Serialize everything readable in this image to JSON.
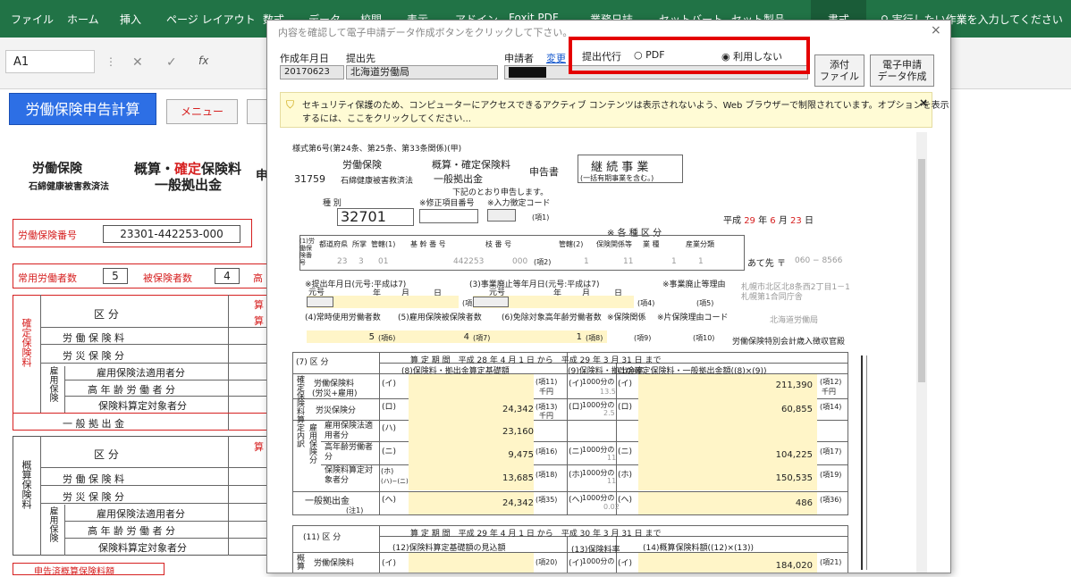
{
  "ribbon": {
    "tabs": [
      "ファイル",
      "ホーム",
      "挿入",
      "ページ レイアウト",
      "数式",
      "データ",
      "校閲",
      "表示",
      "アドイン",
      "Foxit PDF",
      "業務日誌",
      "セットバート",
      "セット製品",
      "書式"
    ],
    "search": "実行したい作業を入力してください"
  },
  "formula_bar": {
    "cell": "A1",
    "fx": "fx"
  },
  "sheet": {
    "title_button": "労働保険申告計算",
    "menu_button": "メニュー",
    "h_ins": "労働保険",
    "h_asb": "石綿健康被害救済法",
    "h_gaisan": "概算・",
    "h_kakutei": "確定",
    "h_hoken": "保険料",
    "h_ippan": "一般拠出金",
    "h_shin": "申",
    "label_no": "労働保険番号",
    "val_no": "23301-442253-000",
    "label_workers": "常用労働者数",
    "val_workers": "5",
    "label_ins": "被保険者数",
    "val_ins": "4",
    "label_ko": "高",
    "kubun": "区 分",
    "kaku_side": "確定保険料",
    "gai_side": "概算保険料",
    "row_rodo": "労 働 保 険 料",
    "row_rosai": "労 災 保 険 分",
    "koyou_side": "雇用保険",
    "row_tekiyo": "雇用保険法適用者分",
    "row_korei": "高 年 齢 労 働 者 分",
    "row_taisho": "保険料算定対象者分",
    "row_ippan": "一 般 拠 出 金",
    "bottom": "申告済概算保険料額",
    "cell_san": "算",
    "cell_ken": "算"
  },
  "dialog": {
    "title": "内容を確認して電子申請データ作成ボタンをクリックして下さい。",
    "close": "×",
    "label_date": "作成年月日",
    "label_dest": "提出先",
    "val_date": "20170623",
    "val_dest": "北海道労働局",
    "label_applicant": "申請者",
    "link_change": "変更",
    "label_agent": "提出代行",
    "opt_pdf": "PDF",
    "opt_none": "利用しない",
    "btn_attach_1": "添付",
    "btn_attach_2": "ファイル",
    "btn_create_1": "電子申請",
    "btn_create_2": "データ作成",
    "security_1": "セキュリティ保護のため、コンピューターにアクセスできるアクティブ コンテンツは表示されないよう、Web ブラウザーで制限されています。オプションを表示",
    "security_2": "するには、ここをクリックしてください..."
  },
  "form": {
    "style": "様式第6号(第24条、第25条、第33条関係)(甲)",
    "code": "31759",
    "rodo": "労働保険",
    "ishiwata": "石綿健康被害救済法",
    "gaisan": "概算・確定保険料",
    "ippan": "一般拠出金",
    "shinkoku": "申告書",
    "keizoku": "継 続 事 業",
    "ikkatsu": "(一括有期事業を含む。)",
    "shita": "下記のとおり申告します。",
    "shubetsu": "種 別",
    "shubetsu_val": "32701",
    "shusei": "※修正項目番号",
    "nyuryoku": "※入力徴定コード",
    "k1": "(項1)",
    "heisei": "平成",
    "yr": "29",
    "nen": "年",
    "mo": "6",
    "tsuki": "月",
    "dy": "23",
    "hi": "日",
    "kakushu": "※ 各 種 区 分",
    "r_label": "(1)労働保険番号",
    "h_todo": "都道府県",
    "h_sho": "所掌",
    "h_kan": "管轄(1)",
    "h_kikan": "基 幹 番 号",
    "h_eda": "枝 番 号",
    "h_kankatsu2": "管轄(2)",
    "h_kankei": "保険関係等",
    "h_gyo": "業 種",
    "h_sangyo": "産業分類",
    "v_todo": "23",
    "v_sho": "3",
    "v_kan": "01",
    "v_kikan": "442253",
    "v_eda": "000",
    "k2": "(項2)",
    "v_kankatsu": "1",
    "v_kankei": "11",
    "v_gyo": "1",
    "v_sangyo": "1",
    "atesaki": "あて先 〒",
    "zip": "060 − 8566",
    "teishutsu": "※提出年月日(元号:平成は7)",
    "jigyo_haishi": "(3)事業廃止等年月日(元号:平成は7)",
    "haishi_riyu": "※事業廃止等理由",
    "addr1": "札幌市北区北8条西2丁目1－1",
    "addr2": "札幌第1合同庁舎",
    "gengo": "元号",
    "nen2": "年",
    "gatsu": "月",
    "nichi": "日",
    "k3": "(項3)",
    "k4": "(項4)",
    "k5": "(項5)",
    "joji": "(4)常時使用労働者数",
    "hihoken": "(5)雇用保険被保険者数",
    "menjo": "(6)免除対象高年齢労働者数",
    "hoken_kankei": "※保険関係",
    "kata_riyu": "※片保険理由コード",
    "kyoku": "北海道労働局",
    "v_joji": "5",
    "k6": "(項6)",
    "v_hihoken": "4",
    "k7": "(項7)",
    "v_menjo": "1",
    "k8": "(項8)",
    "k9": "(項9)",
    "k10": "(項10)",
    "tokubetsu": "労働保険特別会計歳入徴収官殿",
    "t_kubun": "(7) 区 分",
    "t_santei": "算 定 期 間",
    "t_h": "平成",
    "t_28": "28",
    "t_nen": "年",
    "t_4": "4",
    "t_gatsu": "月",
    "t_1": "1",
    "t_kara": "日 から",
    "t_h2": "平成",
    "t_29": "29",
    "t_nen2": "年",
    "t_3": "3",
    "t_gatsu2": "月",
    "t_31": "31",
    "t_made": "日 まで",
    "c8": "(8)保険料・拠出金算定基礎額",
    "c9": "(9)保険料・拠出金率",
    "c10": "(10)確定保険料・一般拠出金額((8)×(9))",
    "side_kaku": "確定保険料算定内訳",
    "r_rodo": "労働保険料",
    "r_rodo2": "(労災+雇用)",
    "r_i": "(イ)",
    "k11": "(項11)",
    "senyen": "千円",
    "r_1000": "1000分の",
    "rate_i": "13.5",
    "v_10i": "211,390",
    "k12": "(項12)",
    "r_rosai": "労災保険分",
    "r_ro": "(ロ)",
    "v_8ro": "24,342",
    "k13": "(項13)",
    "rate_ro": "2.5",
    "v_10ro": "60,855",
    "k14": "(項14)",
    "side_koyo": "雇用保険分",
    "r_tekiyo": "雇用保険法適用者分",
    "r_ha": "(ハ)",
    "v_8ha": "23,160",
    "r_korei": "高年齢労働者分",
    "r_ni": "(ニ)",
    "v_8ni": "9,475",
    "k16": "(項16)",
    "rate_ni": "11",
    "v_10ni": "104,225",
    "k17": "(項17)",
    "r_taisho": "保険料算定対象者分",
    "r_ho": "(ホ)",
    "r_ho2": "(ハ)−(ニ)",
    "v_8ho": "13,685",
    "k18": "(項18)",
    "rate_ho": "11",
    "v_10ho": "150,535",
    "k19": "(項19)",
    "r_ippan": "一般拠出金",
    "r_he": "(ヘ)",
    "r_chu": "(注1)",
    "v_8he": "24,342",
    "k35": "(項35)",
    "rate_he": "0.02",
    "v_10he": "486",
    "k36": "(項36)",
    "t2_kubun": "(11) 区 分",
    "t2_h": "平成",
    "t2_29": "29",
    "t2_h2": "平成",
    "t2_30": "30",
    "c12": "(12)保険料算定基礎額の見込額",
    "c13": "(13)保険料率",
    "c14": "(14)概算保険料額((12)×(13))",
    "side_gai": "概算",
    "r2_rodo": "労働保険料",
    "k20": "(項20)",
    "v2_14": "184,020",
    "k21": "(項21)"
  }
}
